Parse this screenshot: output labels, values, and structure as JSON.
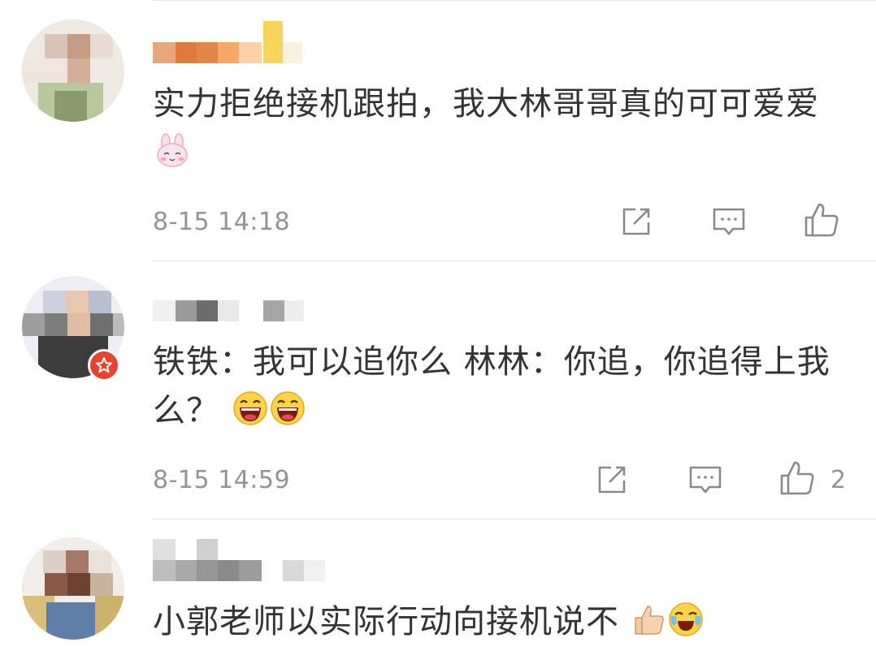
{
  "comments": [
    {
      "text": "实力拒绝接机跟拍，我大林哥哥真的可可爱爱",
      "emoji": "bunny-emoji",
      "time": "8-15 14:18",
      "like_count": "",
      "avatar_colors": [
        "#e8d8d2",
        "#c9a894",
        "#b7c79b",
        "#d8c8b8"
      ],
      "name_colors": [
        "#e8a77a",
        "#e07a3c",
        "#e0884c",
        "#f5a86a",
        "#f6d55a"
      ]
    },
    {
      "text": "铁铁：我可以追你么  林林：你追，你追得上我么？",
      "emoji": "laughing-emoji",
      "time": "8-15 14:59",
      "like_count": "2",
      "avatar_colors": [
        "#c8ccd8",
        "#8c8c8c",
        "#e8c8b0",
        "#404040"
      ],
      "name_colors": [
        "#d0d0d0",
        "#9a9a9a",
        "#6a6a6a",
        "#b0b0b0"
      ]
    },
    {
      "text": "小郭老师以实际行动向接机说不",
      "emoji": "thumbs-up-crying-emoji",
      "time": "",
      "like_count": "",
      "avatar_colors": [
        "#d8c8c0",
        "#a07060",
        "#7a5040",
        "#6a8ab0"
      ],
      "name_colors": [
        "#c8c8c8",
        "#a0a0a0",
        "#888888",
        "#d8d8d8"
      ]
    }
  ],
  "colors": {
    "text": "#333333",
    "meta": "#939393",
    "icon": "#8a8a8a",
    "divider": "#e6e6e6",
    "badge": "#e8432e"
  },
  "icons": {
    "share": "share-icon",
    "reply": "comment-icon",
    "like": "thumbs-up-icon",
    "badge": "star-badge-icon"
  }
}
